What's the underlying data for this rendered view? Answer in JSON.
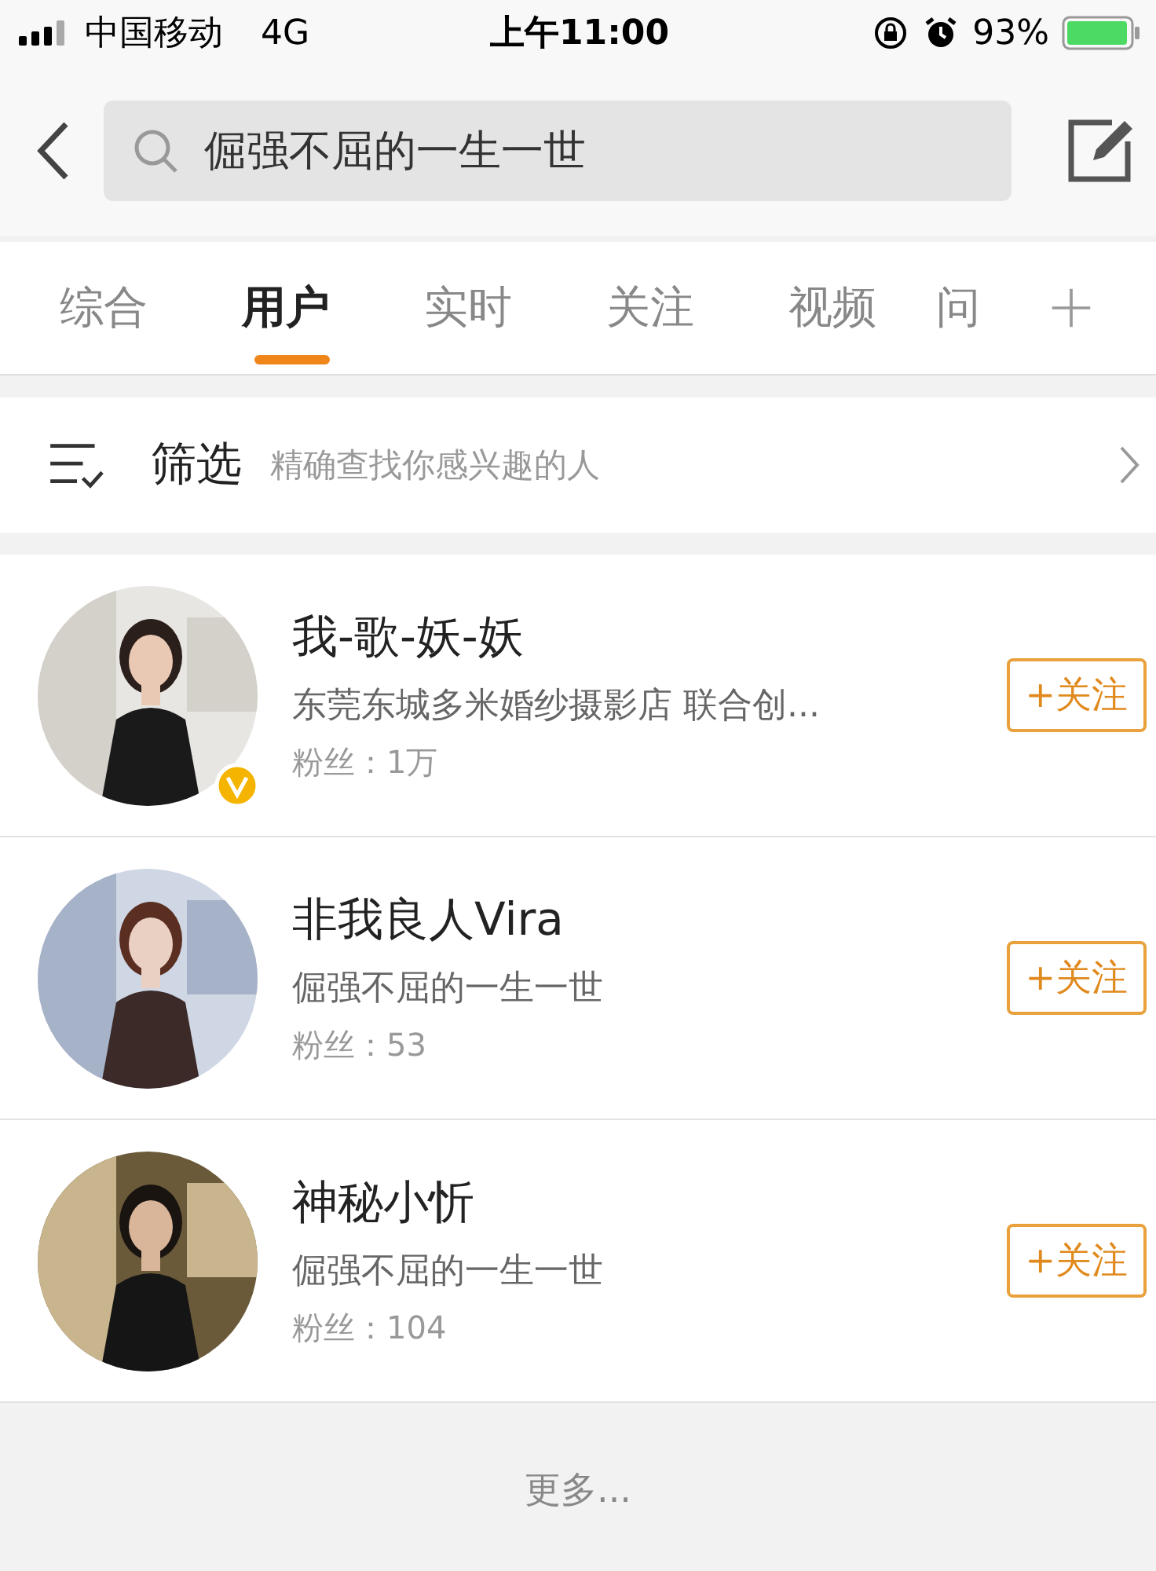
{
  "status_bar": {
    "carrier": "中国移动",
    "network": "4G",
    "time": "上午11:00",
    "battery": "93%"
  },
  "search": {
    "value": "倔强不屈的一生一世"
  },
  "tabs": [
    {
      "label": "综合",
      "selected": false
    },
    {
      "label": "用户",
      "selected": true
    },
    {
      "label": "实时",
      "selected": false
    },
    {
      "label": "关注",
      "selected": false
    },
    {
      "label": "视频",
      "selected": false
    },
    {
      "label": "问",
      "selected": false
    }
  ],
  "filter": {
    "label": "筛选",
    "hint": "精确查找你感兴趣的人"
  },
  "users": [
    {
      "name": "我-歌-妖-妖",
      "bio": "东莞东城多米婚纱摄影店 联合创...",
      "fans": "粉丝：1万",
      "verified": true,
      "follow": "+关注",
      "kind": "picture"
    },
    {
      "name": "非我良人Vira",
      "bio": "倔强不屈的一生一世",
      "fans": "粉丝：53",
      "verified": false,
      "follow": "+关注",
      "kind": "picture"
    },
    {
      "name": "神秘小忻",
      "bio": "倔强不屈的一生一世",
      "fans": "粉丝：104",
      "verified": false,
      "follow": "+关注",
      "kind": "picture"
    }
  ],
  "more": "更多..."
}
